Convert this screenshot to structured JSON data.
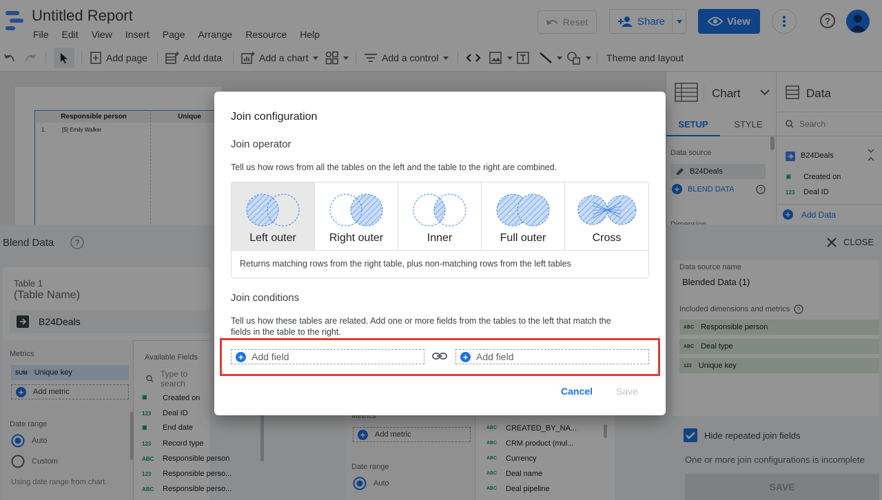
{
  "app": {
    "title": "Untitled Report",
    "menu": [
      "File",
      "Edit",
      "View",
      "Insert",
      "Page",
      "Arrange",
      "Resource",
      "Help"
    ],
    "reset_label": "Reset",
    "share_label": "Share",
    "view_label": "View"
  },
  "toolbar": {
    "add_page": "Add page",
    "add_data": "Add data",
    "add_chart": "Add a chart",
    "add_control": "Add a control",
    "theme": "Theme and layout"
  },
  "report": {
    "col1": "Responsible person",
    "col2": "Unique",
    "row_num": "1.",
    "row_val": "[5] Emily Walker"
  },
  "chart_panel": {
    "title": "Chart",
    "tab_setup": "SETUP",
    "tab_style": "STYLE",
    "data_source_label": "Data source",
    "data_source": "B24Deals",
    "blend_data": "BLEND DATA",
    "dimension_label": "Dimension"
  },
  "data_panel": {
    "title": "Data",
    "search_placeholder": "Search",
    "source": "B24Deals",
    "fields": [
      {
        "type": "date",
        "name": "Created on"
      },
      {
        "type": "123",
        "name": "Deal ID"
      }
    ],
    "add_data": "Add Data"
  },
  "blend": {
    "title": "Blend Data",
    "close": "CLOSE",
    "table1_label": "Table 1",
    "table1_name": "(Table Name)",
    "table1_source": "B24Deals",
    "metrics_label": "Metrics",
    "metric_item": {
      "type": "SUM",
      "name": "Unique key"
    },
    "add_metric": "Add metric",
    "date_range_label": "Date range",
    "date_auto": "Auto",
    "date_custom": "Custom",
    "date_note": "Using date range from chart.",
    "available_fields": "Available Fields",
    "search_placeholder": "Type to search",
    "fields_left": [
      {
        "type": "date",
        "name": "Created on"
      },
      {
        "type": "123",
        "name": "Deal ID"
      },
      {
        "type": "date",
        "name": "End date"
      },
      {
        "type": "123",
        "name": "Record type"
      },
      {
        "type": "ABC",
        "name": "Responsible person"
      },
      {
        "type": "123",
        "name": "Responsible perso..."
      },
      {
        "type": "ABC",
        "name": "Responsible perso..."
      }
    ],
    "table2_metrics_label": "Metrics",
    "table2_add_metric": "Add metric",
    "table2_date_range": "Date range",
    "table2_date_auto": "Auto",
    "fields_right": [
      {
        "type": "ABC",
        "name": "CREATED_BY_NA..."
      },
      {
        "type": "ABC",
        "name": "CRM product (mul..."
      },
      {
        "type": "ABC",
        "name": "Currency"
      },
      {
        "type": "ABC",
        "name": "Deal name"
      },
      {
        "type": "ABC",
        "name": "Deal pipeline"
      }
    ],
    "ds_name_label": "Data source name",
    "ds_name": "Blended Data (1)",
    "included_label": "Included dimensions and metrics",
    "included": [
      {
        "type": "ABC",
        "name": "Responsible person"
      },
      {
        "type": "ABC",
        "name": "Deal type"
      },
      {
        "type": "123",
        "name": "Unique key"
      }
    ],
    "hide_repeated": "Hide repeated join fields",
    "incomplete_msg": "One or more join configurations is incomplete",
    "save": "SAVE"
  },
  "dialog": {
    "title": "Join configuration",
    "operator_heading": "Join operator",
    "operator_desc": "Tell us how rows from all the tables on the left and the table to the right are combined.",
    "options": [
      "Left outer",
      "Right outer",
      "Inner",
      "Full outer",
      "Cross"
    ],
    "selected": "Left outer",
    "option_desc": "Returns matching rows from the right table, plus non-matching rows from the left tables",
    "conditions_heading": "Join conditions",
    "conditions_desc_1": "Tell us how these tables are related. Add one or more fields from the tables to the left that match the",
    "conditions_desc_2": "fields in the table to the right.",
    "add_field_left": "Add field",
    "add_field_right": "Add field",
    "cancel": "Cancel",
    "save": "Save"
  },
  "colors": {
    "accent": "#1a73e8",
    "highlight": "#e53935",
    "included_bg": "#dfeedd"
  }
}
